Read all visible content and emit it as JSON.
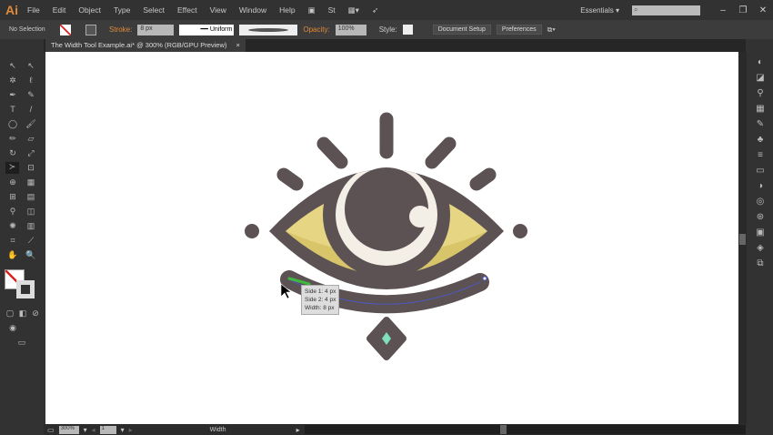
{
  "app": {
    "logo": "Ai",
    "menu": [
      "File",
      "Edit",
      "Object",
      "Type",
      "Select",
      "Effect",
      "View",
      "Window",
      "Help"
    ],
    "workspace": "Essentials ▾",
    "search_placeholder": ""
  },
  "control": {
    "selection": "No Selection",
    "stroke_label": "Stroke:",
    "stroke_value": "8 px",
    "profile": "Uniform",
    "opacity_label": "Opacity:",
    "opacity_value": "100%",
    "style_label": "Style:",
    "document_setup": "Document Setup",
    "preferences": "Preferences"
  },
  "document": {
    "tab_title": "The Width Tool Example.ai* @ 300% (RGB/GPU Preview)",
    "close": "×"
  },
  "tooltip": {
    "side1": "Side 1: 4 px",
    "side2": "Side 2: 4 px",
    "width": "Width: 8 px"
  },
  "status": {
    "zoom": "300%",
    "artboard": "1",
    "tool": "Width"
  },
  "colors": {
    "dark": "#5c5253",
    "yellow": "#e6d684",
    "cream": "#f3eee6",
    "accent": "#e08a3a"
  }
}
